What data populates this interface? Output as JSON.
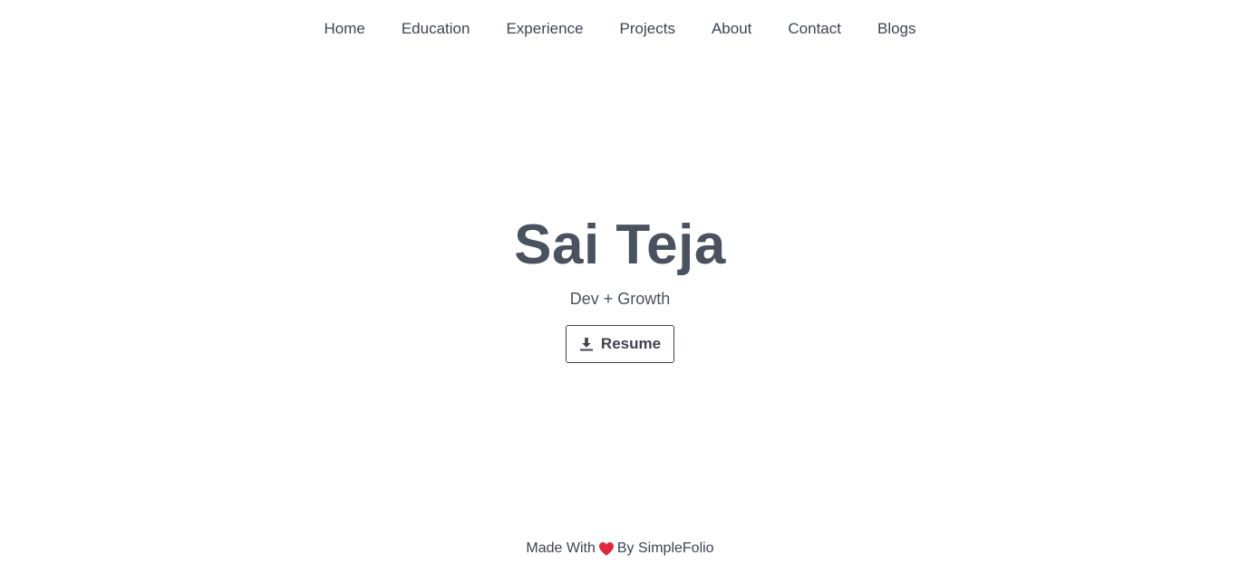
{
  "nav": {
    "items": [
      {
        "label": "Home"
      },
      {
        "label": "Education"
      },
      {
        "label": "Experience"
      },
      {
        "label": "Projects"
      },
      {
        "label": "About"
      },
      {
        "label": "Contact"
      },
      {
        "label": "Blogs"
      }
    ]
  },
  "hero": {
    "name": "Sai Teja",
    "tagline": "Dev + Growth",
    "resume_button": {
      "label": "Resume",
      "icon": "download-icon"
    }
  },
  "footer": {
    "prefix": "Made With",
    "icon": "heart-icon",
    "suffix": "By SimpleFolio"
  },
  "colors": {
    "text": "#3d4451",
    "heart": "#e0283a",
    "background": "#ffffff"
  }
}
